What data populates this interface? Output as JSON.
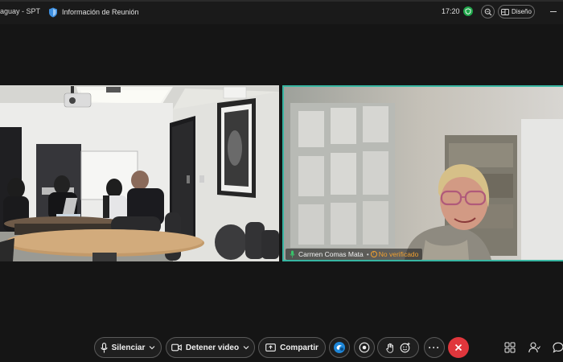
{
  "topbar": {
    "meeting_title": "aguay - SPT",
    "info_label": "Información de Reunión",
    "time": "17:20",
    "layout_label": "Diseño"
  },
  "participants": {
    "remote_name": "Carmen Comas Mata",
    "remote_status": "No verificado"
  },
  "controls": {
    "mute_label": "Silenciar",
    "video_label": "Detener video",
    "share_label": "Compartir",
    "more_label": "···"
  },
  "colors": {
    "accent_border": "#38b6a2",
    "end_call": "#e0363c",
    "status_green": "#1fa64a",
    "unverified": "#f0a030"
  },
  "icons": [
    "shield-icon",
    "zoom-icon",
    "layout-icon",
    "microphone-icon",
    "camera-icon",
    "share-screen-icon",
    "apps-icon",
    "record-icon",
    "raise-hand-icon",
    "reactions-icon",
    "end-call-icon",
    "breakout-icon",
    "participants-icon",
    "chat-icon"
  ]
}
